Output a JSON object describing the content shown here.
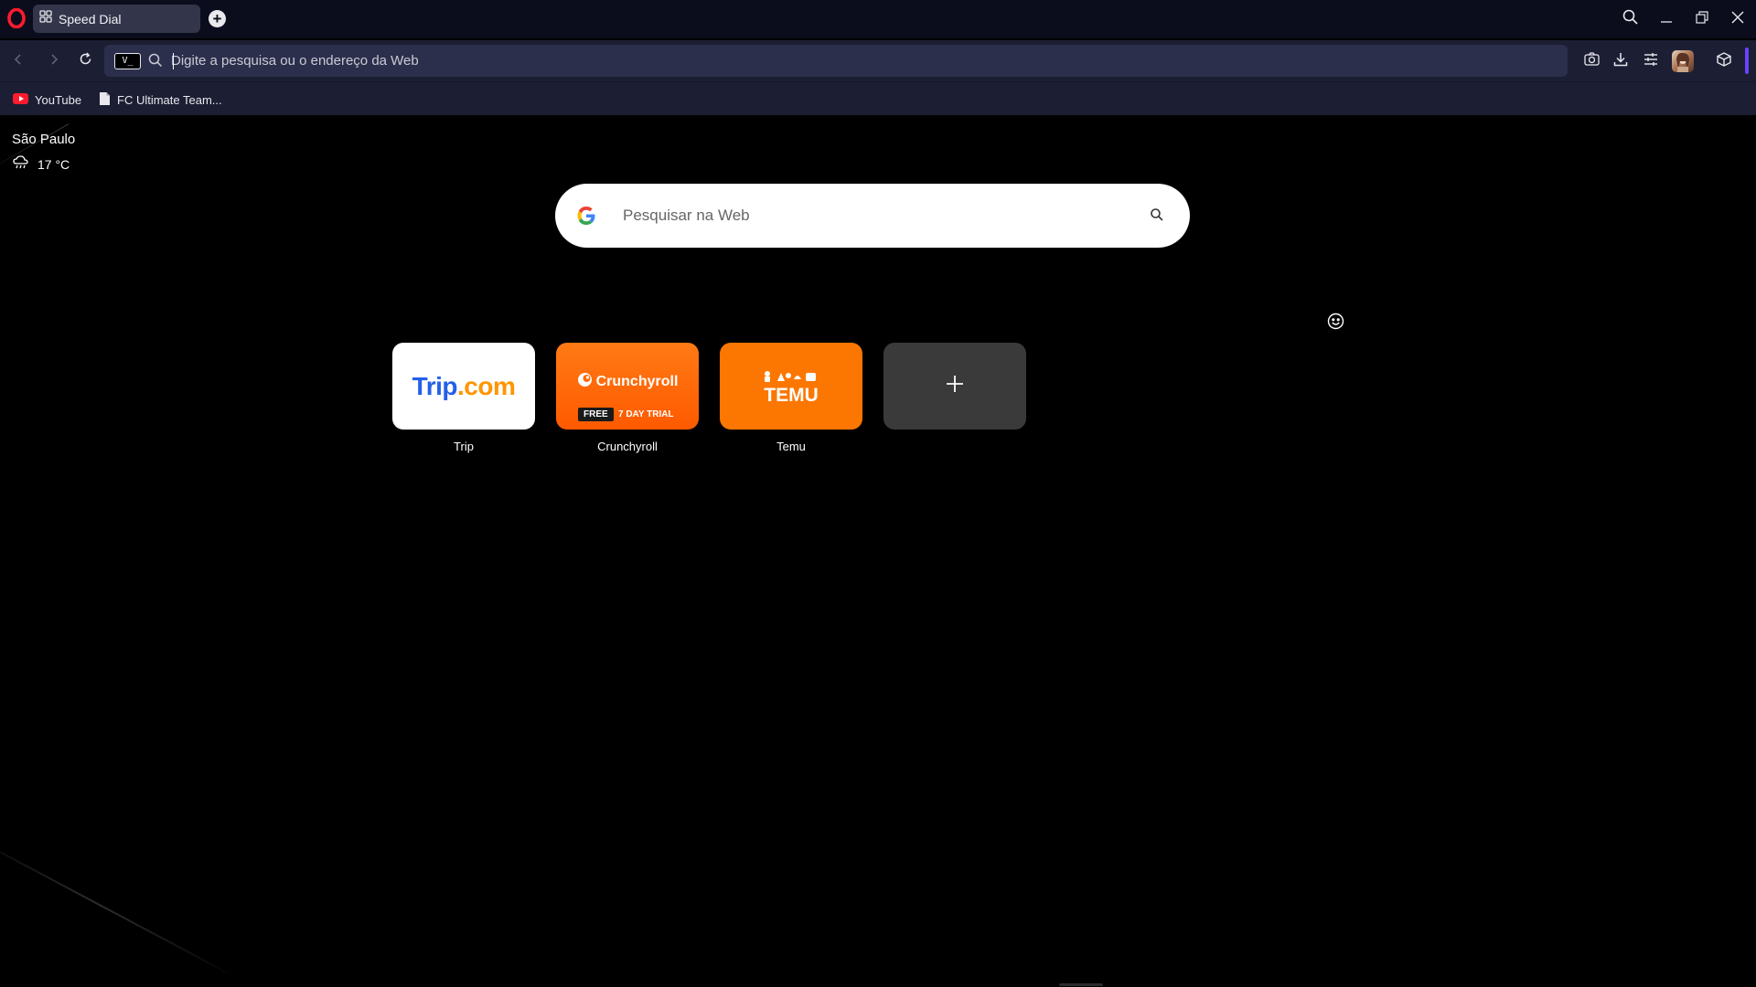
{
  "browser": {
    "tab": {
      "title": "Speed Dial"
    },
    "address_bar": {
      "vpn_label": "V_",
      "placeholder": "Digite a pesquisa ou o endereço da Web",
      "value": ""
    }
  },
  "bookmarks": [
    {
      "label": "YouTube",
      "icon": "youtube-icon"
    },
    {
      "label": "FC Ultimate Team...",
      "icon": "page-icon"
    }
  ],
  "weather": {
    "city": "São Paulo",
    "temperature": "17 °C",
    "icon": "rain-cloud-icon"
  },
  "search": {
    "placeholder": "Pesquisar na Web",
    "engine": "google"
  },
  "speed_dial": [
    {
      "label": "Trip",
      "logo_text": "Trip",
      "logo_suffix": ".com",
      "bg": "#ffffff"
    },
    {
      "label": "Crunchyroll",
      "logo_text": "Crunchyroll",
      "badge": "FREE",
      "badge_text": "7 DAY  TRIAL",
      "bg": "#ff5a00"
    },
    {
      "label": "Temu",
      "logo_text": "TEMU",
      "bg": "#fb7701"
    },
    {
      "label": "",
      "icon": "plus-icon",
      "bg": "#3a3a3a"
    }
  ],
  "colors": {
    "titlebar": "#0c0d1c",
    "toolbar": "#1c1e33",
    "urlbar": "#2c2f4b",
    "accent": "#6a43ff",
    "opera_red": "#ff1b2d"
  }
}
